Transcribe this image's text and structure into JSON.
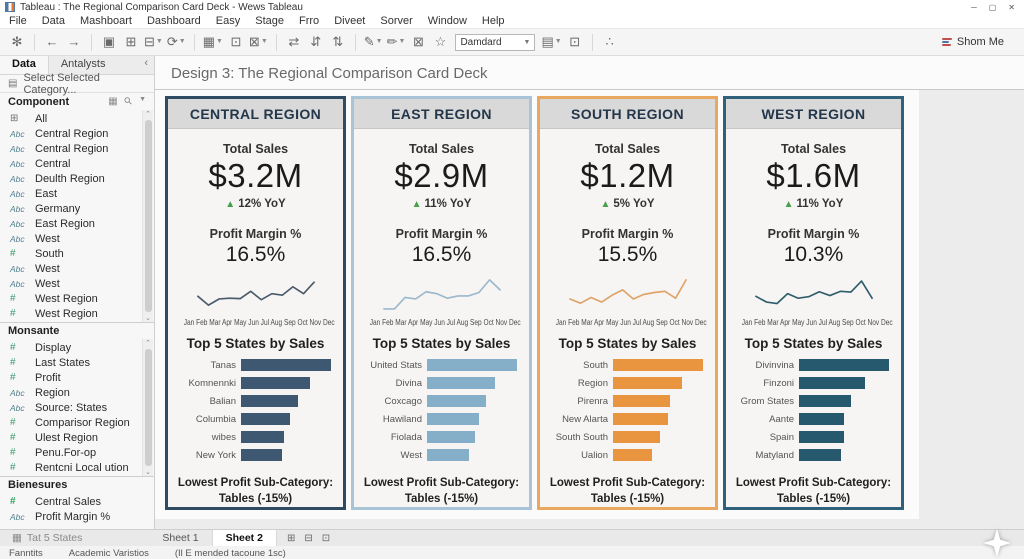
{
  "window": {
    "title": "Tableau : The Regional Comparison Card Deck - Wews Tableau",
    "minimize": "─",
    "maximize": "▢",
    "close": "✕"
  },
  "menu": {
    "items": [
      "File",
      "Data",
      "Mashboart",
      "Dashboard",
      "Easy",
      "Stage",
      "Frro",
      "Diveet",
      "Sorver",
      "Window",
      "Help"
    ]
  },
  "toolbar": {
    "preset_value": "Damdard",
    "show_me_label": "Shom Me",
    "items": [
      {
        "name": "tableau-logo-icon",
        "glyph": "✻"
      },
      {
        "sep": true
      },
      {
        "name": "undo-icon",
        "glyph": "←"
      },
      {
        "name": "redo-icon",
        "glyph": "→"
      },
      {
        "sep": true
      },
      {
        "name": "save-icon",
        "glyph": "▣"
      },
      {
        "name": "add-data-source-icon",
        "glyph": "⊞"
      },
      {
        "name": "pause-updates-icon",
        "glyph": "⊟",
        "dropdown": true
      },
      {
        "name": "refresh-data-icon",
        "glyph": "⟳",
        "dropdown": true
      },
      {
        "sep": true
      },
      {
        "name": "new-worksheet-icon",
        "glyph": "▦",
        "dropdown": true
      },
      {
        "name": "duplicate-sheet-icon",
        "glyph": "⊡"
      },
      {
        "name": "clear-sheet-icon",
        "glyph": "⊠",
        "dropdown": true
      },
      {
        "sep": true
      },
      {
        "name": "swap-axes-icon",
        "glyph": "⇄"
      },
      {
        "name": "sort-ascending-icon",
        "glyph": "⇵"
      },
      {
        "name": "sort-descending-icon",
        "glyph": "⇅"
      },
      {
        "sep": true
      },
      {
        "name": "highlight-icon",
        "glyph": "✎",
        "dropdown": true
      },
      {
        "name": "format-icon",
        "glyph": "✏",
        "dropdown": true
      },
      {
        "name": "show-mark-labels-icon",
        "glyph": "⊠"
      },
      {
        "name": "fix-axes-icon",
        "glyph": "☆"
      },
      {
        "select": true
      },
      {
        "name": "show-hide-cards-icon",
        "glyph": "▤",
        "dropdown": true
      },
      {
        "name": "presentation-mode-icon",
        "glyph": "⊡"
      },
      {
        "sep": true
      },
      {
        "name": "share-icon",
        "glyph": "∴"
      }
    ]
  },
  "sidebar": {
    "tabs": [
      {
        "label": "Data",
        "active": true
      },
      {
        "label": "Antalysts",
        "active": false
      }
    ],
    "collapse_label": "‹",
    "category_selector": "Select Selected Category...",
    "dimensions": {
      "header": "Component",
      "items": [
        {
          "type": "table",
          "label": "All"
        },
        {
          "type": "abc",
          "label": "Central Region"
        },
        {
          "type": "abc",
          "label": "Central Region"
        },
        {
          "type": "abc",
          "label": "Central"
        },
        {
          "type": "abc",
          "label": "Deulth Region"
        },
        {
          "type": "abc",
          "label": "East"
        },
        {
          "type": "abc",
          "label": "Germany"
        },
        {
          "type": "abc",
          "label": "East Region"
        },
        {
          "type": "abc",
          "label": "West"
        },
        {
          "type": "hash",
          "label": "South"
        },
        {
          "type": "abc",
          "label": "West"
        },
        {
          "type": "abc",
          "label": "West"
        },
        {
          "type": "hash",
          "label": "West Region"
        },
        {
          "type": "hash",
          "label": "West Region"
        }
      ]
    },
    "measures": {
      "header": "Monsante",
      "items": [
        {
          "type": "hash",
          "label": "Display"
        },
        {
          "type": "hash",
          "label": "Last States"
        },
        {
          "type": "hash",
          "label": "Profit"
        },
        {
          "type": "abc",
          "label": "Region"
        },
        {
          "type": "abc",
          "label": "Source: States"
        },
        {
          "type": "hash",
          "label": "Comparisor Region"
        },
        {
          "type": "hash",
          "label": "Ulest Region"
        },
        {
          "type": "hash",
          "label": "Penu.For-op"
        },
        {
          "type": "hash",
          "label": "Rentcni Local ution"
        }
      ]
    },
    "parameters": {
      "header": "Bienesures",
      "items": [
        {
          "type": "hashg",
          "label": "Central Sales"
        },
        {
          "type": "abc",
          "label": "Profit Margin %"
        }
      ]
    }
  },
  "canvas": {
    "title": "Design 3: The Regional Comparison Card Deck"
  },
  "chart_data": [
    {
      "region": "CENTRAL REGION",
      "accent": "#2f4a63",
      "total_sales_label": "Total Sales",
      "total_sales": "$3.2M",
      "yoy": "12% YoY",
      "yoy_direction": "up",
      "profit_margin_label": "Profit Margin %",
      "profit_margin": "16.5%",
      "sparkline": {
        "type": "line",
        "color": "#4a5b6c",
        "x": [
          "Jan",
          "Feb",
          "Mar",
          "Apr",
          "May",
          "Jun",
          "Jul",
          "Aug",
          "Sep",
          "Oct",
          "Nov",
          "Dec"
        ],
        "values": [
          45,
          22,
          38,
          40,
          39,
          58,
          36,
          52,
          48,
          70,
          52,
          82
        ]
      },
      "months_label": "Jan Feb Mar Apr May Jun  Jul  Aug Sep Oct Nov Dec",
      "top_states": {
        "type": "bar",
        "title": "Top 5 States by Sales",
        "color": "#3e5871",
        "categories": [
          "Tanas",
          "Komnennki",
          "Balian",
          "Columbia",
          "wibes",
          "New York"
        ],
        "values": [
          100,
          77,
          63,
          54,
          48,
          45
        ]
      },
      "footer_line1": "Lowest Profit Sub-Category:",
      "footer_line2": "Tables (-15%)"
    },
    {
      "region": "EAST REGION",
      "accent": "#aac4d7",
      "total_sales_label": "Total Sales",
      "total_sales": "$2.9M",
      "yoy": "11% YoY",
      "yoy_direction": "up",
      "profit_margin_label": "Profit Margin %",
      "profit_margin": "16.5%",
      "sparkline": {
        "type": "line",
        "color": "#9cb8cc",
        "x": [
          "Jan",
          "Feb",
          "Mar",
          "Apr",
          "May",
          "Jun",
          "Jul",
          "Aug",
          "Sep",
          "Oct",
          "Nov",
          "Dec"
        ],
        "values": [
          12,
          12,
          42,
          38,
          57,
          52,
          40,
          46,
          46,
          55,
          88,
          62
        ]
      },
      "months_label": "Jan Feb Mar Apr May Jun  Jul  Aug Sep Oct Nov Dec",
      "top_states": {
        "type": "bar",
        "title": "Top 5 States by Sales",
        "color": "#85aec9",
        "categories": [
          "United Stats",
          "Divina",
          "Coxcago",
          "Hawiland",
          "Fiolada",
          "West"
        ],
        "values": [
          100,
          76,
          66,
          58,
          53,
          47
        ]
      },
      "footer_line1": "Lowest Profit Sub-Category:",
      "footer_line2": "Tables (-15%)"
    },
    {
      "region": "SOUTH REGION",
      "accent": "#e9a85f",
      "total_sales_label": "Total Sales",
      "total_sales": "$1.2M",
      "yoy": "5% YoY",
      "yoy_direction": "up",
      "profit_margin_label": "Profit Margin %",
      "profit_margin": "15.5%",
      "sparkline": {
        "type": "line",
        "color": "#dfa368",
        "x": [
          "Jan",
          "Feb",
          "Mar",
          "Apr",
          "May",
          "Jun",
          "Jul",
          "Aug",
          "Sep",
          "Oct",
          "Nov",
          "Dec"
        ],
        "values": [
          38,
          27,
          42,
          30,
          48,
          62,
          38,
          50,
          55,
          58,
          40,
          88
        ]
      },
      "months_label": "Jan Feb Mar Apr May Jun  Jul  Aug Sep Oct Nov Dec",
      "top_states": {
        "type": "bar",
        "title": "Top 5 States by Sales",
        "color": "#e9953f",
        "categories": [
          "South",
          "Region",
          "Pirenra",
          "New Alarta",
          "South South",
          "Ualion"
        ],
        "values": [
          100,
          77,
          63,
          61,
          52,
          43
        ]
      },
      "footer_line1": "Lowest Profit Sub-Category:",
      "footer_line2": "Tables (-15%)"
    },
    {
      "region": "WEST REGION",
      "accent": "#2f617a",
      "total_sales_label": "Total Sales",
      "total_sales": "$1.6M",
      "yoy": "11% YoY",
      "yoy_direction": "up",
      "profit_margin_label": "Profit Margin %",
      "profit_margin": "10.3%",
      "sparkline": {
        "type": "line",
        "color": "#2f5d6b",
        "x": [
          "Jan",
          "Feb",
          "Mar",
          "Apr",
          "May",
          "Jun",
          "Jul",
          "Aug",
          "Sep",
          "Oct",
          "Nov",
          "Dec"
        ],
        "values": [
          45,
          30,
          26,
          52,
          40,
          44,
          57,
          47,
          58,
          56,
          85,
          40
        ]
      },
      "months_label": "Jan Feb Mar Apr May Jun  Jul  Aug Sep Oct Nov Dec",
      "top_states": {
        "type": "bar",
        "title": "Top 5 States by Sales",
        "color": "#27596e",
        "categories": [
          "Divinvina",
          "Finzoni",
          "Grom States",
          "Aante",
          "Spain",
          "Matyland"
        ],
        "values": [
          100,
          73,
          58,
          50,
          50,
          47
        ]
      },
      "footer_line1": "Lowest Profit Sub-Category:",
      "footer_line2": "Tables (-15%)"
    }
  ],
  "bottombar": {
    "data_source_tab": "Tat 5 States",
    "sheet_tabs": [
      {
        "label": "Sheet 1",
        "active": false
      },
      {
        "label": "Sheet 2",
        "active": true
      }
    ],
    "status_items": [
      "Fanntits",
      "Academic Varistios",
      "(Il E mended tacoune 1sc)"
    ]
  }
}
